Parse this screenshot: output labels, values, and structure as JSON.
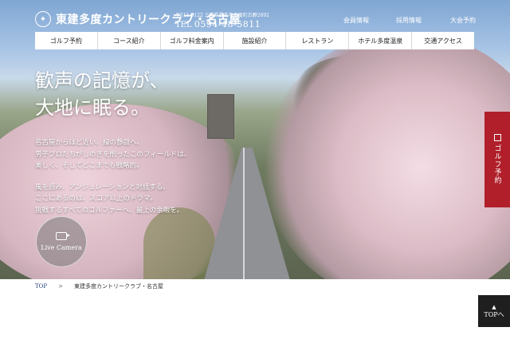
{
  "header": {
    "logo": "東建多度カントリークラブ・名古屋",
    "address": "〒511-0122 三重県桑名市多度町古野2692",
    "tel_label": "TEL",
    "tel": "0594-48-5811",
    "utility": [
      "会員情報",
      "採用情報",
      "大会予約"
    ]
  },
  "nav": [
    "ゴルフ予約",
    "コース紹介",
    "ゴルフ料金案内",
    "施設紹介",
    "レストラン",
    "ホテル多度温泉",
    "交通アクセス"
  ],
  "hero": {
    "catch_line1": "歓声の記憶が、",
    "catch_line2": "大地に眠る。",
    "lead": [
      "名古屋からほど近い、緑の静寂へ。",
      "男子プロたちがしのぎを削ったこのフィールドは、",
      "美しく、そしてどこまでも戦略的。",
      "",
      "風を読み、アンジュレーションと対話する。",
      "ここにあるのは、スコア以上のドラマ。",
      "挑戦するすべてのゴルファーへ、最上の余暇を。"
    ],
    "live_camera": "Live Camera"
  },
  "side_reserve": "ゴルフ予約",
  "breadcrumb": {
    "home": "TOP",
    "sep": ">",
    "current": "東建多度カントリークラブ・名古屋"
  },
  "top_button": {
    "arrow": "▲",
    "label": "TOPへ"
  },
  "colors": {
    "accent_red": "#b01f2a",
    "link_blue": "#233f7a",
    "nav_bg": "#ffffff",
    "top_btn_bg": "#1f1f1f"
  }
}
